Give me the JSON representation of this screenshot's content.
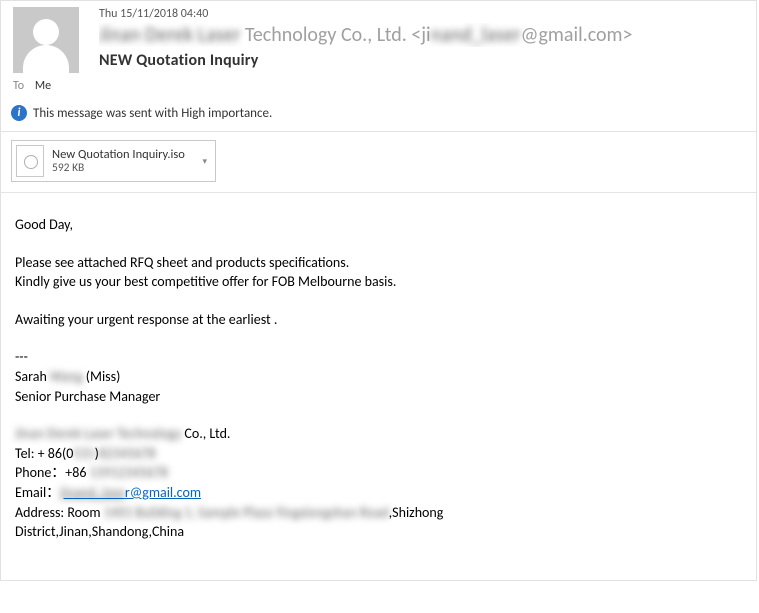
{
  "header": {
    "date": "Thu 15/11/2018 04:40",
    "from_prefix_blur": "Jinan Derek Laser",
    "from_mid": " Technology Co., Ltd. <ji",
    "from_blur2": "nand_laser",
    "from_suffix": "@gmail.com>",
    "subject": "NEW Quotation Inquiry",
    "to_label": "To",
    "to_value": "Me"
  },
  "info": {
    "text": "This message was sent with High importance."
  },
  "attachment": {
    "name": "New Quotation Inquiry.iso",
    "size": "592 KB"
  },
  "body": {
    "greeting": "Good Day,",
    "line1": "Please see attached RFQ sheet and products specifications.",
    "line2": "Kindly give us your best competitive offer for FOB Melbourne basis.",
    "line3": "Awaiting  your urgent response at the earliest .",
    "sig_sep": "---",
    "sig_name_pre": "Sarah ",
    "sig_name_blur": "Wang",
    "sig_name_suffix": " (Miss)",
    "sig_title": "Senior Purchase Manager",
    "company_pre_blur": "Jinan Derek Laser Technology",
    "company_post": " Co., Ltd.",
    "tel_pre": "Tel: + 86(0",
    "tel_blur1": "531",
    "tel_mid": ")",
    "tel_blur2": "82345678",
    "phone_pre": "Phone：+86 ",
    "phone_blur": "13912345678",
    "email_label": "Email：",
    "email_pre_blur": "jinand_lase",
    "email_post": "r@gmail.com",
    "addr_pre": "Address: Room ",
    "addr_blur": "1401 Building 1, Sample Plaza Yingxiongshan Road",
    "addr_post": ",Shizhong",
    "addr_line2": "District,Jinan,Shandong,China"
  }
}
